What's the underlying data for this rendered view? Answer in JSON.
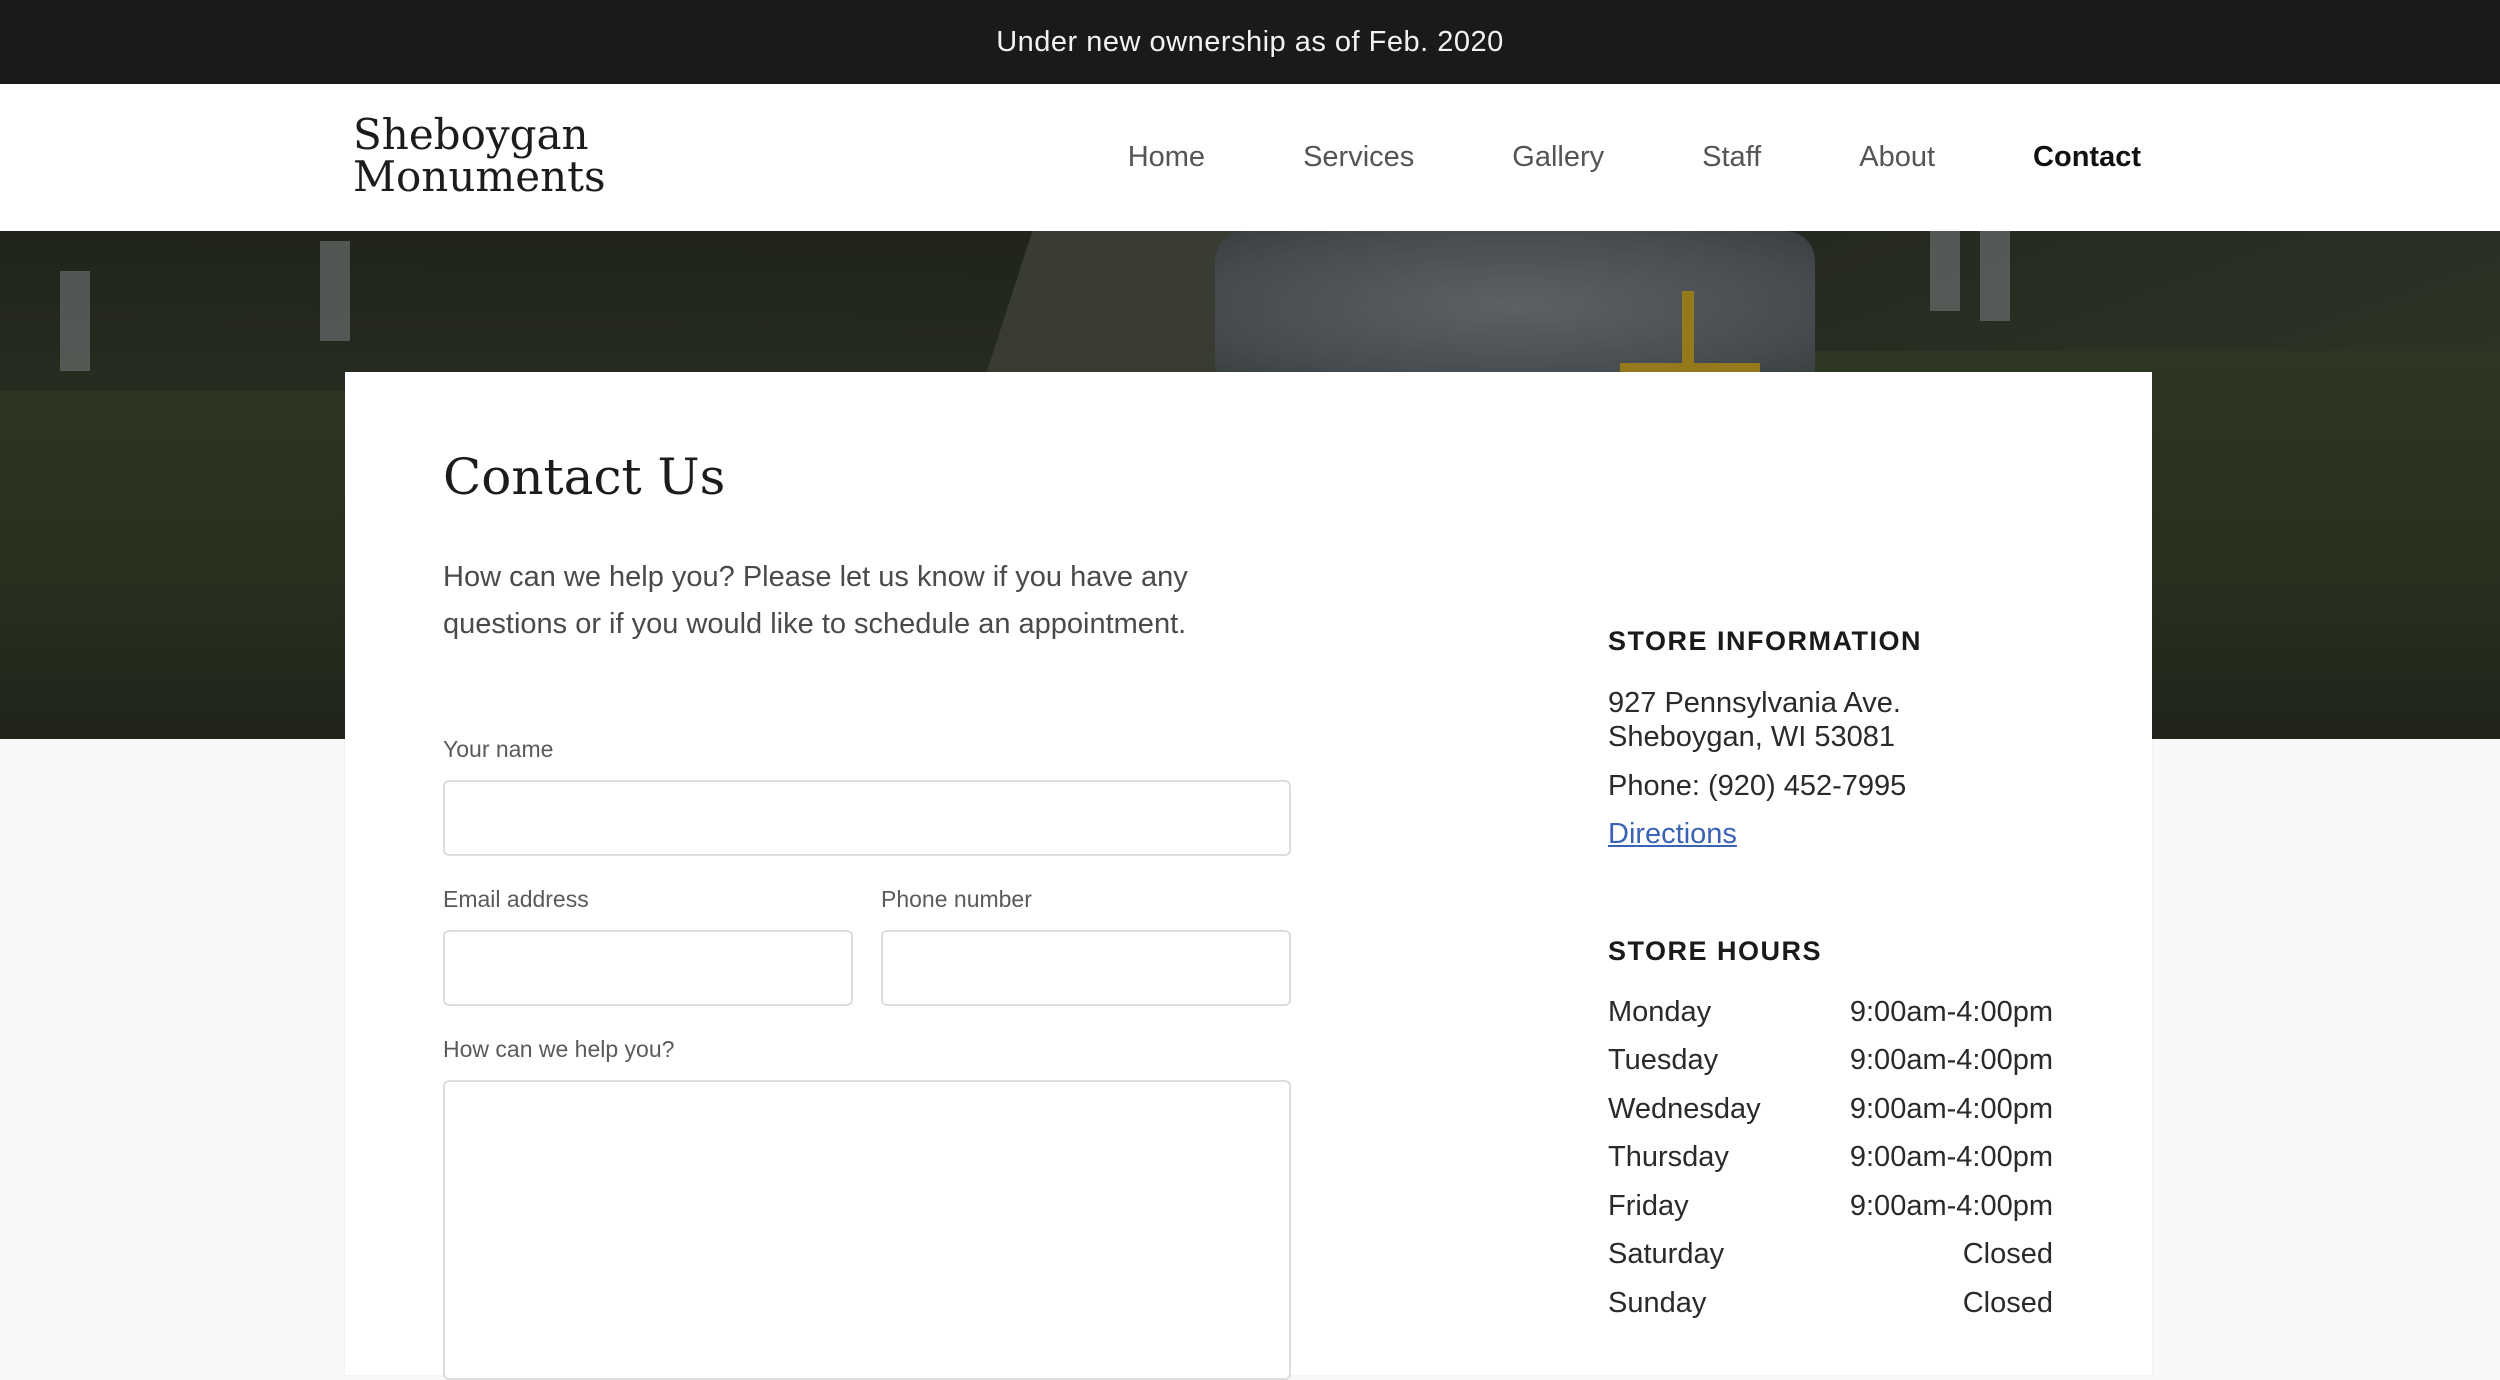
{
  "announcement": "Under new ownership as of Feb. 2020",
  "header": {
    "logo_line1": "Sheboygan",
    "logo_line2": "Monuments",
    "nav": [
      {
        "label": "Home"
      },
      {
        "label": "Services"
      },
      {
        "label": "Gallery"
      },
      {
        "label": "Staff"
      },
      {
        "label": "About"
      },
      {
        "label": "Contact",
        "active": true
      }
    ]
  },
  "contact": {
    "title": "Contact Us",
    "intro": "How can we help you? Please let us know if you have any questions or if you would like to schedule an appointment.",
    "form": {
      "name_label": "Your name",
      "name_value": "",
      "email_label": "Email address",
      "email_value": "",
      "phone_label": "Phone number",
      "phone_value": "",
      "message_label": "How can we help you?",
      "message_value": ""
    }
  },
  "store_info": {
    "heading": "STORE INFORMATION",
    "address_line1": "927 Pennsylvania Ave.",
    "address_line2": "Sheboygan, WI 53081",
    "phone": "Phone: (920) 452-7995",
    "directions_label": "Directions"
  },
  "store_hours": {
    "heading": "STORE HOURS",
    "rows": [
      {
        "day": "Monday",
        "hours": "9:00am-4:00pm"
      },
      {
        "day": "Tuesday",
        "hours": "9:00am-4:00pm"
      },
      {
        "day": "Wednesday",
        "hours": "9:00am-4:00pm"
      },
      {
        "day": "Thursday",
        "hours": "9:00am-4:00pm"
      },
      {
        "day": "Friday",
        "hours": "9:00am-4:00pm"
      },
      {
        "day": "Saturday",
        "hours": "Closed"
      },
      {
        "day": "Sunday",
        "hours": "Closed"
      }
    ]
  },
  "colors": {
    "announcement_bg": "#1a1a1a",
    "link": "#3b63b5",
    "page_bg": "#f8f8f8"
  }
}
